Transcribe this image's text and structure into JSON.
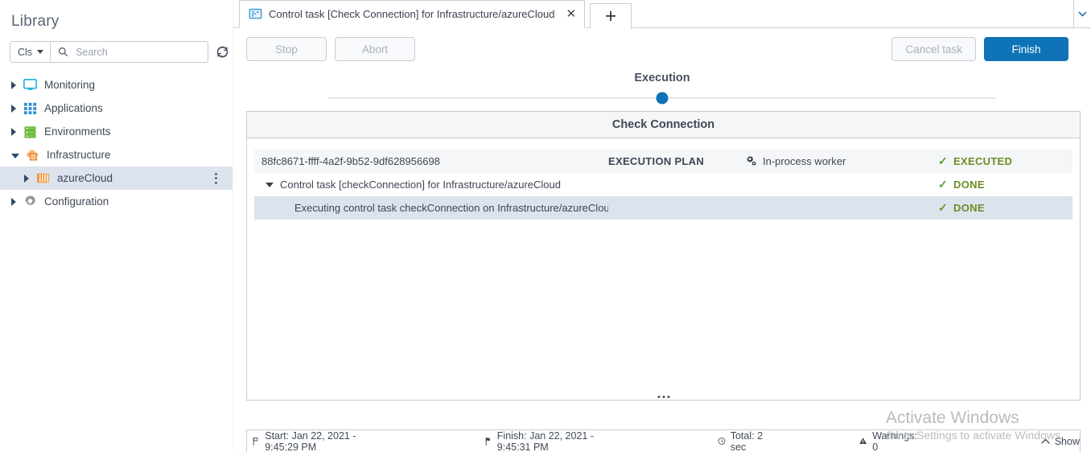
{
  "sidebar": {
    "title": "Library",
    "search": {
      "scope_label": "Cls",
      "placeholder": "Search",
      "value": ""
    },
    "refresh_icon": "refresh-icon",
    "tree": [
      {
        "label": "Monitoring",
        "icon": "monitor-icon",
        "expanded": false,
        "selected": false,
        "depth": 0
      },
      {
        "label": "Applications",
        "icon": "grid-apps-icon",
        "expanded": false,
        "selected": false,
        "depth": 0
      },
      {
        "label": "Environments",
        "icon": "server-stack-icon",
        "expanded": false,
        "selected": false,
        "depth": 0
      },
      {
        "label": "Infrastructure",
        "icon": "cloud-grid-icon",
        "expanded": true,
        "selected": false,
        "depth": 0
      },
      {
        "label": "azureCloud",
        "icon": "barcode-icon",
        "expanded": false,
        "selected": true,
        "depth": 1
      },
      {
        "label": "Configuration",
        "icon": "gear-icon",
        "expanded": false,
        "selected": false,
        "depth": 0
      }
    ]
  },
  "tabs": {
    "active": {
      "label": "Control task [Check Connection] for Infrastructure/azureCloud",
      "icon": "task-monitor-icon",
      "close_icon": "close-icon"
    },
    "add_label": "+",
    "overflow_icon": "chevron-down-icon"
  },
  "toolbar": {
    "stop_label": "Stop",
    "abort_label": "Abort",
    "cancel_label": "Cancel task",
    "finish_label": "Finish",
    "primary_color": "#0f73b7"
  },
  "stepper": {
    "title": "Execution",
    "dot_color": "#0f73b7"
  },
  "panel": {
    "header": "Check Connection",
    "columns": [
      "name",
      "plan",
      "worker",
      "status"
    ],
    "rows": [
      {
        "name": "88fc8671-ffff-4a2f-9b52-9df628956698",
        "plan": "EXECUTION PLAN",
        "worker": "In-process worker",
        "worker_icon": "gears-icon",
        "status": "EXECUTED",
        "status_icon": "check-icon",
        "style": "head",
        "indent": 0,
        "toggle": ""
      },
      {
        "name": "Control task [checkConnection] for Infrastructure/azureCloud",
        "plan": "",
        "worker": "",
        "worker_icon": "",
        "status": "DONE",
        "status_icon": "check-icon",
        "style": "plain",
        "indent": 1,
        "toggle": "expanded"
      },
      {
        "name": "Executing control task checkConnection on Infrastructure/azureCloud",
        "plan": "",
        "worker": "",
        "worker_icon": "",
        "status": "DONE",
        "status_icon": "check-icon",
        "style": "sel",
        "indent": 2,
        "toggle": ""
      }
    ],
    "resize_icon": "drag-dots-icon"
  },
  "statusbar": {
    "start": "Start: Jan 22, 2021 - 9:45:29 PM",
    "start_icon": "flag-start-icon",
    "finish": "Finish: Jan 22, 2021 - 9:45:31 PM",
    "finish_icon": "flag-finish-icon",
    "total": "Total: 2 sec",
    "total_icon": "clock-icon",
    "warnings": "Warnings: 0",
    "warnings_icon": "warning-triangle-icon",
    "show": "Show",
    "show_icon": "chevron-up-icon"
  },
  "watermark": {
    "line1": "Activate Windows",
    "line2": "Go to Settings to activate Windows"
  }
}
